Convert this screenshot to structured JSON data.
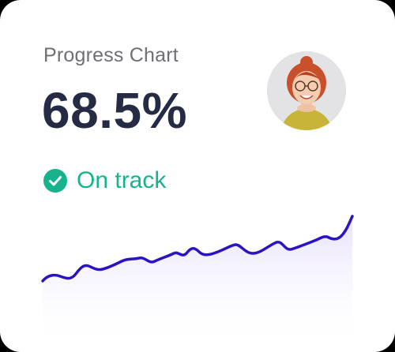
{
  "card": {
    "title": "Progress Chart",
    "value": "68.5%",
    "status": {
      "label": "On track",
      "icon": "check-circle-icon",
      "color": "#17b38d"
    },
    "avatar": {
      "icon": "user-avatar"
    }
  },
  "colors": {
    "title": "#6f6f78",
    "value": "#252b45",
    "line": "#2a13c4",
    "area_top": "#e7e1fb"
  }
}
